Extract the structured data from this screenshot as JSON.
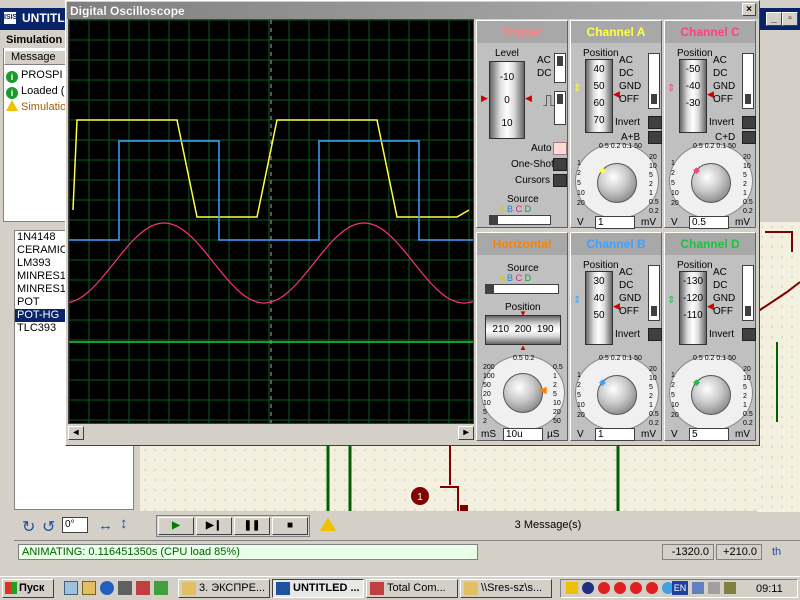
{
  "background_app": {
    "title": "UNTITLED -",
    "sim_panel_title": "Simulation",
    "message_header": "Message",
    "messages": [
      {
        "type": "info",
        "text": "PROSPI"
      },
      {
        "type": "info",
        "text": "Loaded ("
      },
      {
        "type": "warn",
        "text": "Simulatio"
      }
    ],
    "devices": [
      "1N4148",
      "CERAMIC",
      "LM393",
      "MINRES1",
      "MINRES1",
      "POT",
      "POT-HG",
      "TLC393"
    ],
    "selected_device": "POT-HG",
    "angle_value": "0°",
    "message_count": "3 Message(s)",
    "status": "ANIMATING: 0.116451350s (CPU load 85%)",
    "coord_x": "-1320.0",
    "coord_y": "+210.0",
    "units": "th",
    "probe_label": "1"
  },
  "oscilloscope": {
    "title": "Digital Oscilloscope",
    "trigger": {
      "title": "Trigger",
      "level_label": "Level",
      "drum_ticks": [
        "-10",
        "0",
        "10"
      ],
      "ac": "AC",
      "dc": "DC",
      "auto": "Auto",
      "one_shot": "One-Shot",
      "cursors": "Cursors",
      "source_label": "Source",
      "source_opts": [
        "A",
        "B",
        "C",
        "D"
      ]
    },
    "horizontal": {
      "title": "Horizontal",
      "source_label": "Source",
      "source_opts": [
        "A",
        "B",
        "C",
        "D"
      ],
      "position_label": "Position",
      "position_ticks": [
        "210",
        "200",
        "190"
      ],
      "timebase_value": "10u",
      "unit_left": "mS",
      "unit_right": "µS",
      "knob_left_ticks": [
        "200",
        "100",
        "50",
        "20",
        "10",
        "5",
        "2",
        "1"
      ],
      "knob_top_ticks": [
        "0.5",
        "0.2",
        "0.1"
      ],
      "knob_right_ticks": [
        "0.5",
        "1",
        "2",
        "5",
        "10",
        "20",
        "50",
        "100",
        "200"
      ]
    },
    "channels": [
      {
        "id": "A",
        "title": "Channel A",
        "color": "#ffff40",
        "position_ticks": [
          "40",
          "50",
          "60",
          "70"
        ],
        "value": "1",
        "unit_left": "V",
        "unit_right": "mV",
        "opts": [
          "AC",
          "DC",
          "GND",
          "OFF"
        ],
        "invert": "Invert",
        "combine": "A+B"
      },
      {
        "id": "C",
        "title": "Channel C",
        "color": "#ff4080",
        "position_ticks": [
          "-50",
          "-40",
          "-30"
        ],
        "value": "0.5",
        "unit_left": "V",
        "unit_right": "mV",
        "opts": [
          "AC",
          "DC",
          "GND",
          "OFF"
        ],
        "invert": "Invert",
        "combine": "C+D"
      },
      {
        "id": "B",
        "title": "Channel B",
        "color": "#40a0ff",
        "position_ticks": [
          "30",
          "40",
          "50"
        ],
        "value": "1",
        "unit_left": "V",
        "unit_right": "mV",
        "opts": [
          "AC",
          "DC",
          "GND",
          "OFF"
        ],
        "invert": "Invert",
        "combine": ""
      },
      {
        "id": "D",
        "title": "Channel D",
        "color": "#20c040",
        "position_ticks": [
          "-130",
          "-120",
          "-110"
        ],
        "value": "5",
        "unit_left": "V",
        "unit_right": "mV",
        "opts": [
          "AC",
          "DC",
          "GND",
          "OFF"
        ],
        "invert": "Invert",
        "combine": ""
      }
    ],
    "volts_knob_ticks_top": [
      "0.5",
      "0.2",
      "0.1",
      "50"
    ],
    "volts_knob_ticks_right": [
      "20",
      "10",
      "5",
      "2",
      "1",
      "0.5",
      "0.2"
    ],
    "volts_knob_ticks_left": [
      "1",
      "2",
      "5",
      "10",
      "20"
    ]
  },
  "taskbar": {
    "start": "Пуск",
    "tasks": [
      "3. ЭКСПРЕ...",
      "UNTITLED ...",
      "Total Com...",
      "\\\\Sres-sz\\s..."
    ],
    "active_task": 1,
    "lang": "EN",
    "clock": "09:11"
  }
}
